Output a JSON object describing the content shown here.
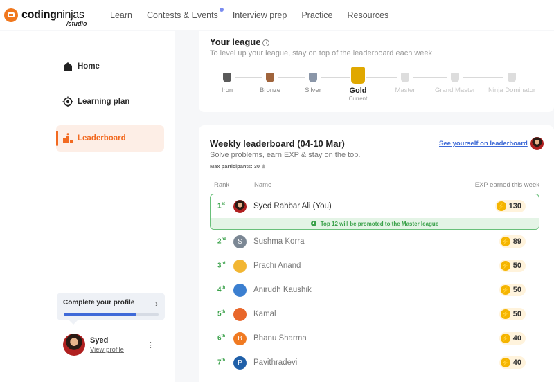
{
  "brand": {
    "name_bold": "coding",
    "name_light": "ninjas",
    "sub": "/studio"
  },
  "nav": [
    {
      "label": "Learn"
    },
    {
      "label": "Contests & Events",
      "dot": true
    },
    {
      "label": "Interview prep"
    },
    {
      "label": "Practice"
    },
    {
      "label": "Resources"
    }
  ],
  "sidebar": {
    "items": [
      {
        "label": "Home"
      },
      {
        "label": "Learning plan"
      },
      {
        "label": "Leaderboard",
        "active": true
      }
    ],
    "profile_card": {
      "title": "Complete your profile",
      "progress": 0.77
    },
    "user": {
      "name": "Syed",
      "link": "View profile"
    }
  },
  "league": {
    "title": "Your league",
    "subtitle": "To level up your league, stay on top of the leaderboard each week",
    "tiers": [
      {
        "name": "Iron",
        "color": "#5a5a5a",
        "state": "done"
      },
      {
        "name": "Bronze",
        "color": "#a0643c",
        "state": "done"
      },
      {
        "name": "Silver",
        "color": "#8a96a8",
        "state": "done"
      },
      {
        "name": "Gold",
        "color": "#e0a800",
        "state": "current",
        "caption": "Current"
      },
      {
        "name": "Master",
        "color": "#dddddd",
        "state": "locked"
      },
      {
        "name": "Grand Master",
        "color": "#dddddd",
        "state": "locked"
      },
      {
        "name": "Ninja Dominator",
        "color": "#dddddd",
        "state": "locked"
      }
    ]
  },
  "leaderboard": {
    "title": "Weekly leaderboard (04-10 Mar)",
    "subtitle": "Solve problems, earn EXP & stay on the top.",
    "max_participants": "Max participants: 30",
    "see_link": "See yourself on leaderboard",
    "columns": {
      "rank": "Rank",
      "name": "Name",
      "exp": "EXP earned this week"
    },
    "me": {
      "rank": "1",
      "suffix": "st",
      "name": "Syed Rahbar Ali (You)",
      "exp": "130",
      "promo": "Top 12 will be promoted to the Master league"
    },
    "rows": [
      {
        "rank": "2",
        "suffix": "nd",
        "name": "Sushma Korra",
        "exp": "89",
        "initial": "S",
        "color": "#7b8794"
      },
      {
        "rank": "3",
        "suffix": "rd",
        "name": "Prachi Anand",
        "exp": "50",
        "initial": "",
        "color": "#f2b633"
      },
      {
        "rank": "4",
        "suffix": "th",
        "name": "Anirudh Kaushik",
        "exp": "50",
        "initial": "",
        "color": "#3b7fd0"
      },
      {
        "rank": "5",
        "suffix": "th",
        "name": "Kamal",
        "exp": "50",
        "initial": "",
        "color": "#e8672b"
      },
      {
        "rank": "6",
        "suffix": "th",
        "name": "Bhanu Sharma",
        "exp": "40",
        "initial": "B",
        "color": "#f07a22"
      },
      {
        "rank": "7",
        "suffix": "th",
        "name": "Pavithradevi",
        "exp": "40",
        "initial": "P",
        "color": "#1f5fa8"
      }
    ]
  }
}
